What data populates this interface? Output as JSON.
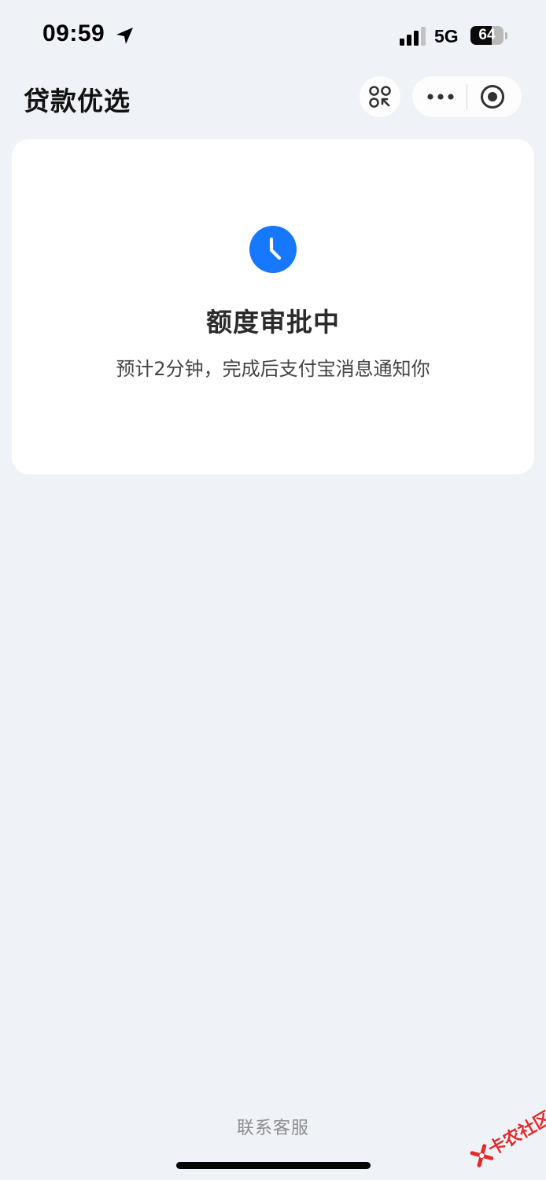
{
  "status_bar": {
    "time": "09:59",
    "network": "5G",
    "battery_text": "64",
    "battery_level": 0.64,
    "icons": [
      "location-arrow-icon",
      "signal-icon",
      "battery-icon"
    ]
  },
  "nav": {
    "title": "贷款优选",
    "icons": [
      "scan-icon",
      "more-icon",
      "close-target-icon"
    ]
  },
  "card": {
    "icon": "clock-icon",
    "title": "额度审批中",
    "subtitle": "预计2分钟，完成后支付宝消息通知你"
  },
  "footer": {
    "contact_label": "联系客服"
  },
  "watermark": {
    "text": "卡农社区"
  },
  "colors": {
    "background": "#eff2f7",
    "accent": "#1677ff",
    "card": "#ffffff",
    "watermark": "#e32a2a"
  }
}
